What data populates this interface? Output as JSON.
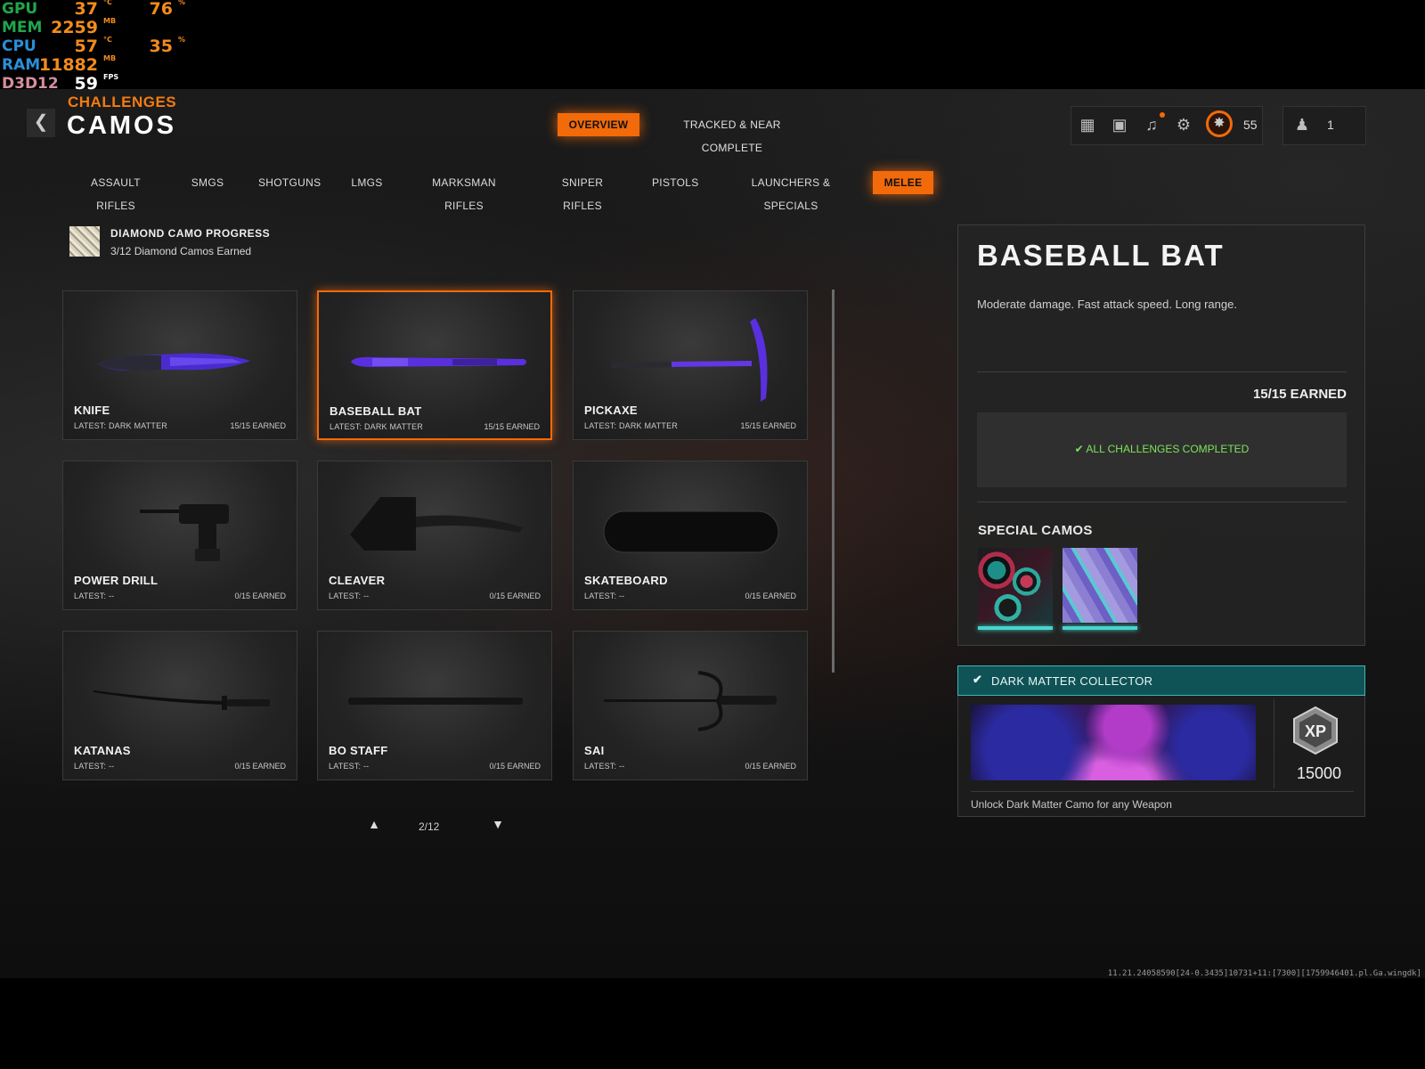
{
  "perf_overlay": {
    "rows": [
      {
        "label": "GPU",
        "v1": "37",
        "u1": "°C",
        "v2": "76",
        "u2": "%",
        "color": "#1fa64b"
      },
      {
        "label": "MEM",
        "v1": "2259",
        "u1": "MB",
        "v2": "",
        "u2": "",
        "color": "#1fa64b"
      },
      {
        "label": "CPU",
        "v1": "57",
        "u1": "°C",
        "v2": "35",
        "u2": "%",
        "color": "#2a8fd8"
      },
      {
        "label": "RAM",
        "v1": "11882",
        "u1": "MB",
        "v2": "",
        "u2": "",
        "color": "#2a8fd8"
      },
      {
        "label": "D3D12",
        "v1": "59",
        "u1": "FPS",
        "v2": "",
        "u2": "",
        "color": "#d58ea0"
      }
    ]
  },
  "header": {
    "kicker": "CHALLENGES",
    "title": "CAMOS",
    "back_icon": "chevron-left-icon",
    "tabs": [
      {
        "label": "OVERVIEW",
        "active": true
      },
      {
        "label": "TRACKED & NEAR COMPLETE",
        "active": false
      }
    ]
  },
  "hud": {
    "icons": [
      "grid-menu-icon",
      "social-icon",
      "bell-icon",
      "gear-icon"
    ],
    "rank_value": "55",
    "party_count": "1"
  },
  "categories": [
    {
      "label": "ASSAULT RIFLES",
      "active": false
    },
    {
      "label": "SMGS",
      "active": false
    },
    {
      "label": "SHOTGUNS",
      "active": false
    },
    {
      "label": "LMGS",
      "active": false
    },
    {
      "label": "MARKSMAN RIFLES",
      "active": false
    },
    {
      "label": "SNIPER RIFLES",
      "active": false
    },
    {
      "label": "PISTOLS",
      "active": false
    },
    {
      "label": "LAUNCHERS & SPECIALS",
      "active": false
    },
    {
      "label": "MELEE",
      "active": true
    }
  ],
  "diamond_progress": {
    "title": "DIAMOND CAMO PROGRESS",
    "subtitle": "3/12 Diamond Camos Earned"
  },
  "weapons": [
    {
      "name": "KNIFE",
      "latest": "LATEST: DARK MATTER",
      "earned": "15/15 EARNED",
      "selected": false
    },
    {
      "name": "BASEBALL BAT",
      "latest": "LATEST: DARK MATTER",
      "earned": "15/15 EARNED",
      "selected": true
    },
    {
      "name": "PICKAXE",
      "latest": "LATEST: DARK MATTER",
      "earned": "15/15 EARNED",
      "selected": false
    },
    {
      "name": "POWER DRILL",
      "latest": "LATEST: --",
      "earned": "0/15 EARNED",
      "selected": false
    },
    {
      "name": "CLEAVER",
      "latest": "LATEST: --",
      "earned": "0/15 EARNED",
      "selected": false
    },
    {
      "name": "SKATEBOARD",
      "latest": "LATEST: --",
      "earned": "0/15 EARNED",
      "selected": false
    },
    {
      "name": "KATANAS",
      "latest": "LATEST: --",
      "earned": "0/15 EARNED",
      "selected": false
    },
    {
      "name": "BO STAFF",
      "latest": "LATEST: --",
      "earned": "0/15 EARNED",
      "selected": false
    },
    {
      "name": "SAI",
      "latest": "LATEST: --",
      "earned": "0/15 EARNED",
      "selected": false
    }
  ],
  "pager": {
    "label": "2/12"
  },
  "detail": {
    "title": "BASEBALL BAT",
    "description": "Moderate damage.  Fast attack speed. Long range.",
    "earned": "15/15 EARNED",
    "status": "ALL CHALLENGES COMPLETED",
    "special_camos_label": "SPECIAL CAMOS"
  },
  "reward": {
    "title": "DARK MATTER COLLECTOR",
    "xp_label": "XP",
    "xp": "15000",
    "description": "Unlock Dark Matter Camo for any Weapon"
  },
  "build_string": "11.21.24058590[24-0.3435]10731+11:[7300][1759946401.pl.Ga.wingdk]",
  "colors": {
    "accent": "#f26a0a",
    "teal": "#3fb6b8",
    "success": "#7ee35a"
  }
}
